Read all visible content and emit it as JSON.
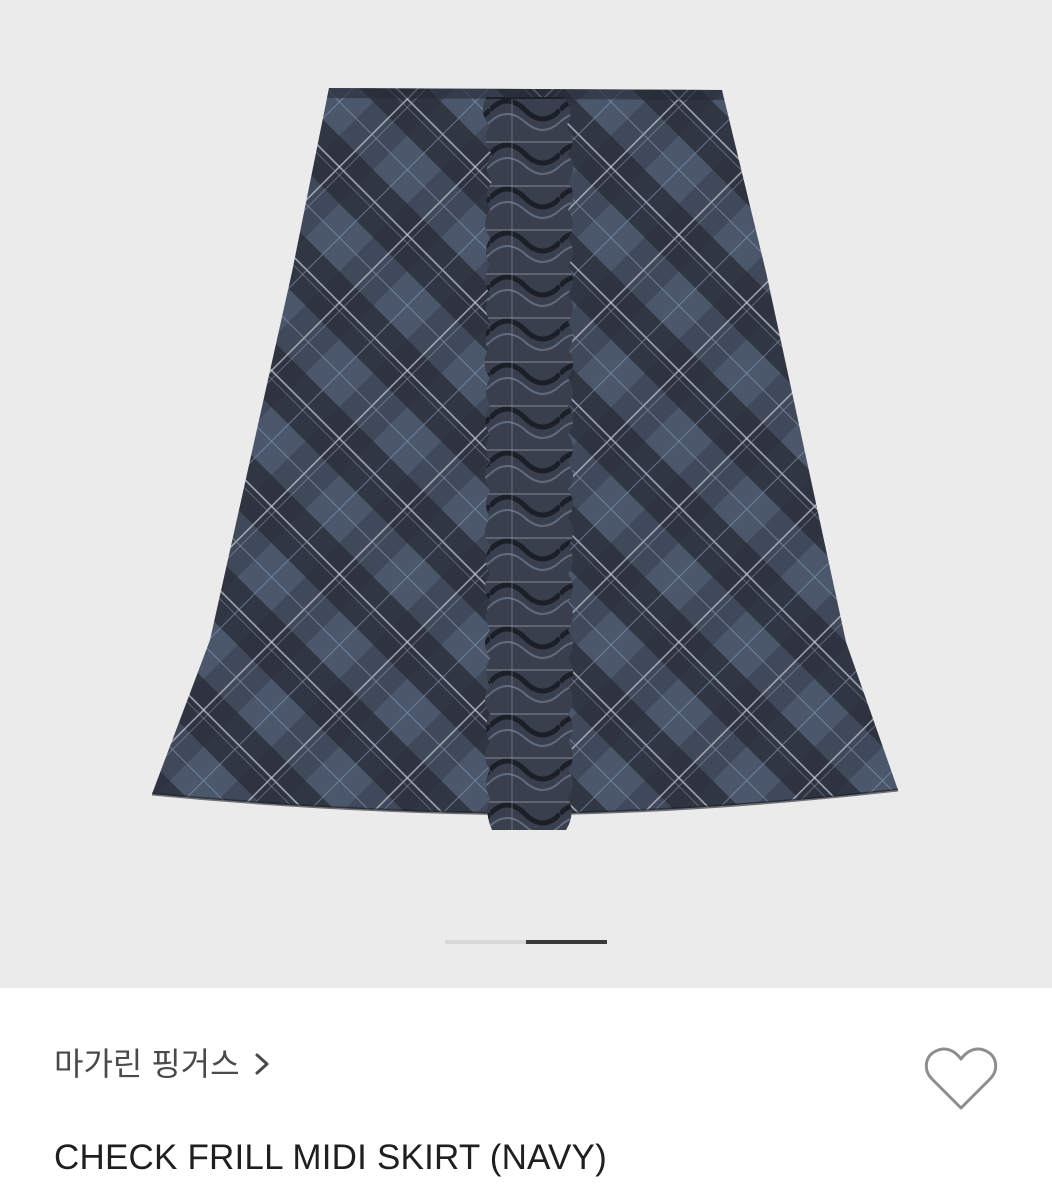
{
  "product": {
    "image_alt": "check frill midi skirt",
    "brand_name": "마가린 핑거스",
    "brand_chevron": "chevron-right-icon",
    "name": "CHECK FRILL MIDI SKIRT (NAVY)",
    "wishlist_icon": "heart-outline-icon"
  },
  "gallery": {
    "pages": 2,
    "current_page": 2
  },
  "colors": {
    "gallery_bg": "#ebebeb",
    "skirt_base": "#2f3340",
    "plaid_blue": "#5a6b7f",
    "plaid_line": "#c9ccd6",
    "text_primary": "#1f1f1f",
    "text_secondary": "#4a4a4a",
    "pager_active": "#3a3a3a",
    "pager_inactive": "#d8d8d8"
  }
}
